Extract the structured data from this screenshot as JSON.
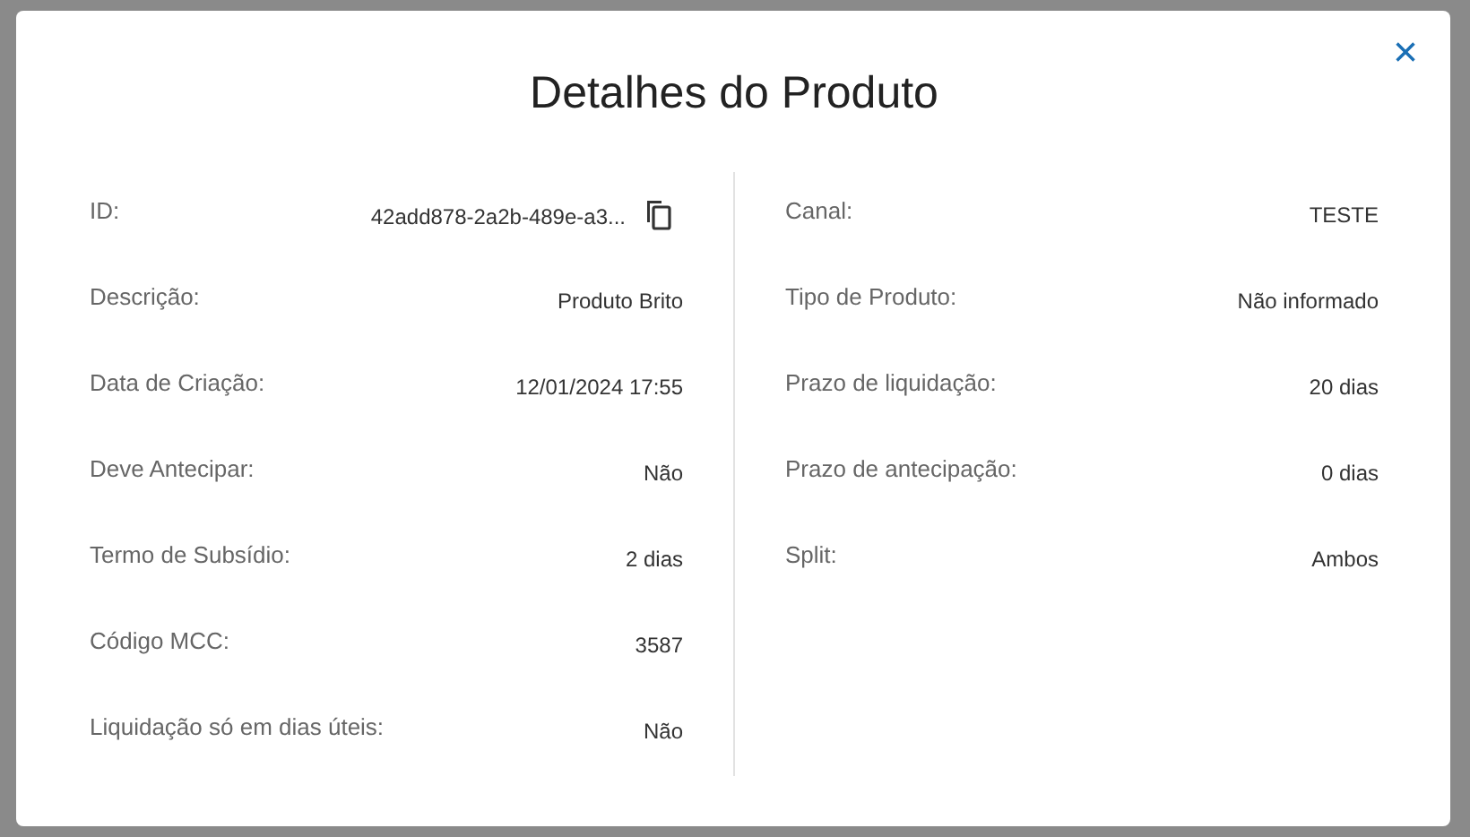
{
  "dialog": {
    "title": "Detalhes do Produto",
    "close": "×",
    "columns": [
      {
        "fields": [
          {
            "kind": "copy",
            "label": "ID:",
            "value": "42add878-2a2b-489e-a3..."
          },
          {
            "kind": "text",
            "label": "Descrição:",
            "value": "Produto Brito"
          },
          {
            "kind": "text",
            "label": "Data de Criação:",
            "value": "12/01/2024 17:55"
          },
          {
            "kind": "text",
            "label": "Deve Antecipar:",
            "value": "Não"
          },
          {
            "kind": "text",
            "label": "Termo de Subsídio:",
            "value": "2 dias"
          },
          {
            "kind": "text",
            "label": "Código MCC:",
            "value": "3587"
          },
          {
            "kind": "text",
            "label": "Liquidação só em dias úteis:",
            "value": "Não"
          }
        ]
      },
      {
        "fields": [
          {
            "kind": "text",
            "label": "Canal:",
            "value": "TESTE"
          },
          {
            "kind": "text",
            "label": "Tipo de Produto:",
            "value": "Não informado"
          },
          {
            "kind": "text",
            "label": "Prazo de liquidação:",
            "value": "20 dias"
          },
          {
            "kind": "text",
            "label": "Prazo de antecipação:",
            "value": "0 dias"
          },
          {
            "kind": "text",
            "label": "Split:",
            "value": "Ambos"
          }
        ]
      }
    ]
  }
}
